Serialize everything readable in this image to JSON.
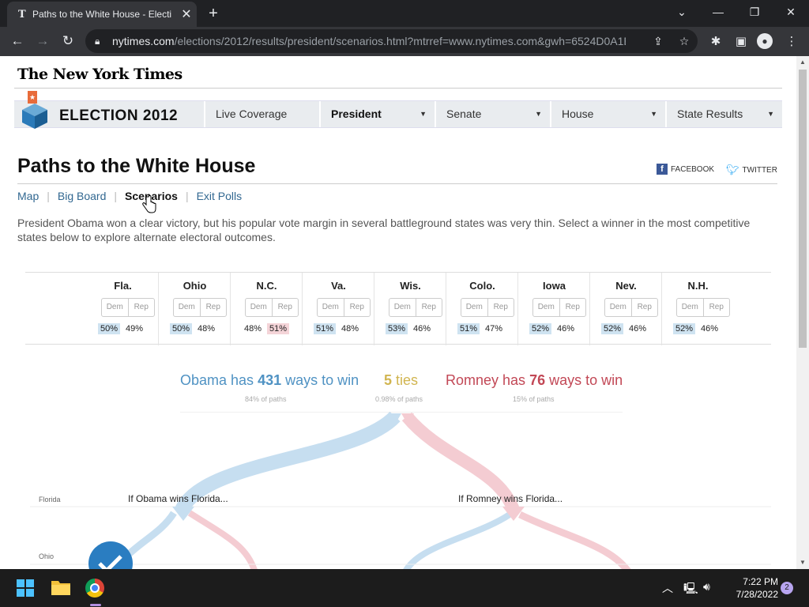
{
  "browser": {
    "tab_title": "Paths to the White House - Electi",
    "tab_favicon": "T",
    "close_tab": "✕",
    "new_tab": "+",
    "url_domain": "nytimes.com",
    "url_path": "/elections/2012/results/president/scenarios.html?mtrref=www.nytimes.com&gwh=6524D0A1B..."
  },
  "header": {
    "logo": "The New York Times",
    "election_title": "ELECTION 2012",
    "nav": [
      {
        "label": "Live Coverage"
      },
      {
        "label": "President",
        "active": true
      },
      {
        "label": "Senate"
      },
      {
        "label": "House"
      },
      {
        "label": "State Results"
      }
    ]
  },
  "page": {
    "title": "Paths to the White House",
    "share_facebook": "FACEBOOK",
    "share_twitter": "TWITTER",
    "subnav": [
      "Map",
      "Big Board",
      "Scenarios",
      "Exit Polls"
    ],
    "subnav_active": "Scenarios",
    "intro": "President Obama won a clear victory, but his popular vote margin in several battleground states was very thin. Select a winner in the most competitive states below to explore alternate electoral outcomes."
  },
  "states": {
    "dem_label": "Dem",
    "rep_label": "Rep",
    "items": [
      {
        "name": "Fla.",
        "dem": "50%",
        "rep": "49%",
        "winner": "dem"
      },
      {
        "name": "Ohio",
        "dem": "50%",
        "rep": "48%",
        "winner": "dem"
      },
      {
        "name": "N.C.",
        "dem": "48%",
        "rep": "51%",
        "winner": "rep"
      },
      {
        "name": "Va.",
        "dem": "51%",
        "rep": "48%",
        "winner": "dem"
      },
      {
        "name": "Wis.",
        "dem": "53%",
        "rep": "46%",
        "winner": "dem"
      },
      {
        "name": "Colo.",
        "dem": "51%",
        "rep": "47%",
        "winner": "dem"
      },
      {
        "name": "Iowa",
        "dem": "52%",
        "rep": "46%",
        "winner": "dem"
      },
      {
        "name": "Nev.",
        "dem": "52%",
        "rep": "46%",
        "winner": "dem"
      },
      {
        "name": "N.H.",
        "dem": "52%",
        "rep": "46%",
        "winner": "dem"
      }
    ]
  },
  "summary": {
    "obama_prefix": "Obama has ",
    "obama_ways": "431",
    "obama_suffix": " ways to win",
    "obama_pct": "84% of paths",
    "ties_count": "5",
    "ties_suffix": " ties",
    "ties_pct": "0.98% of paths",
    "romney_prefix": "Romney has ",
    "romney_ways": "76",
    "romney_suffix": " ways to win",
    "romney_pct": "15% of paths"
  },
  "tree": {
    "row_labels": [
      "Florida",
      "Ohio"
    ],
    "obama_branch": "If Obama wins Florida...",
    "romney_branch": "If Romney wins Florida..."
  },
  "taskbar": {
    "time": "7:22 PM",
    "date": "7/28/2022",
    "notifications": "2"
  },
  "colors": {
    "dem": "#4f92c3",
    "dem_light": "#c6def0",
    "rep": "#c24856",
    "rep_light": "#f4ccd2",
    "tie": "#d1b550"
  }
}
